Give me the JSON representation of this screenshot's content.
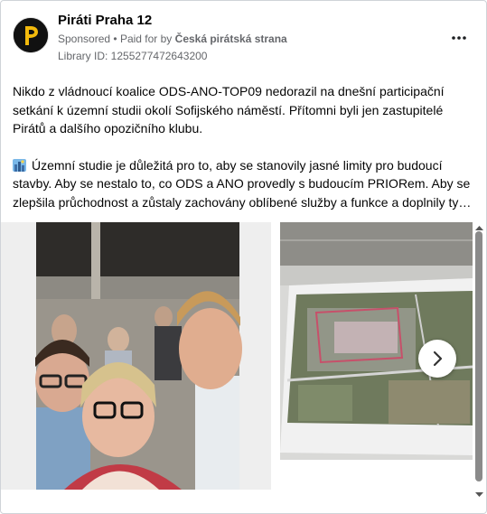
{
  "post": {
    "page_name": "Piráti Praha 12",
    "sponsored": "Sponsored",
    "paid_for_prefix": "Paid for by",
    "paid_for_by": "Česká pirátská strana",
    "library_id": "Library ID: 1255277472643200",
    "paragraph1": "Nikdo z vládnoucí koalice ODS-ANO-TOP09 nedorazil na dnešní participační setkání k územní studii okolí Sofijského náměstí. Přítomni byli jen zastupitelé Pirátů a dalšího opozičního klubu.",
    "paragraph2": "Územní studie je důležitá pro to, aby se stanovily jasné limity pro budoucí stavby. Aby se nestalo to, co ODS a ANO provedly s budoucím PRIORem. Aby se zlepšila průchodnost a zůstaly zachovány oblíbené služby a funkce a doplnily ty…"
  },
  "icons": {
    "avatar": "pirate-party-logo",
    "more": "more-options-icon",
    "emoji": "cityscape-emoji-icon",
    "next": "chevron-right-icon"
  },
  "colors": {
    "secondary_text": "#65676b",
    "primary_text": "#050505",
    "border": "#cfd3d8"
  }
}
